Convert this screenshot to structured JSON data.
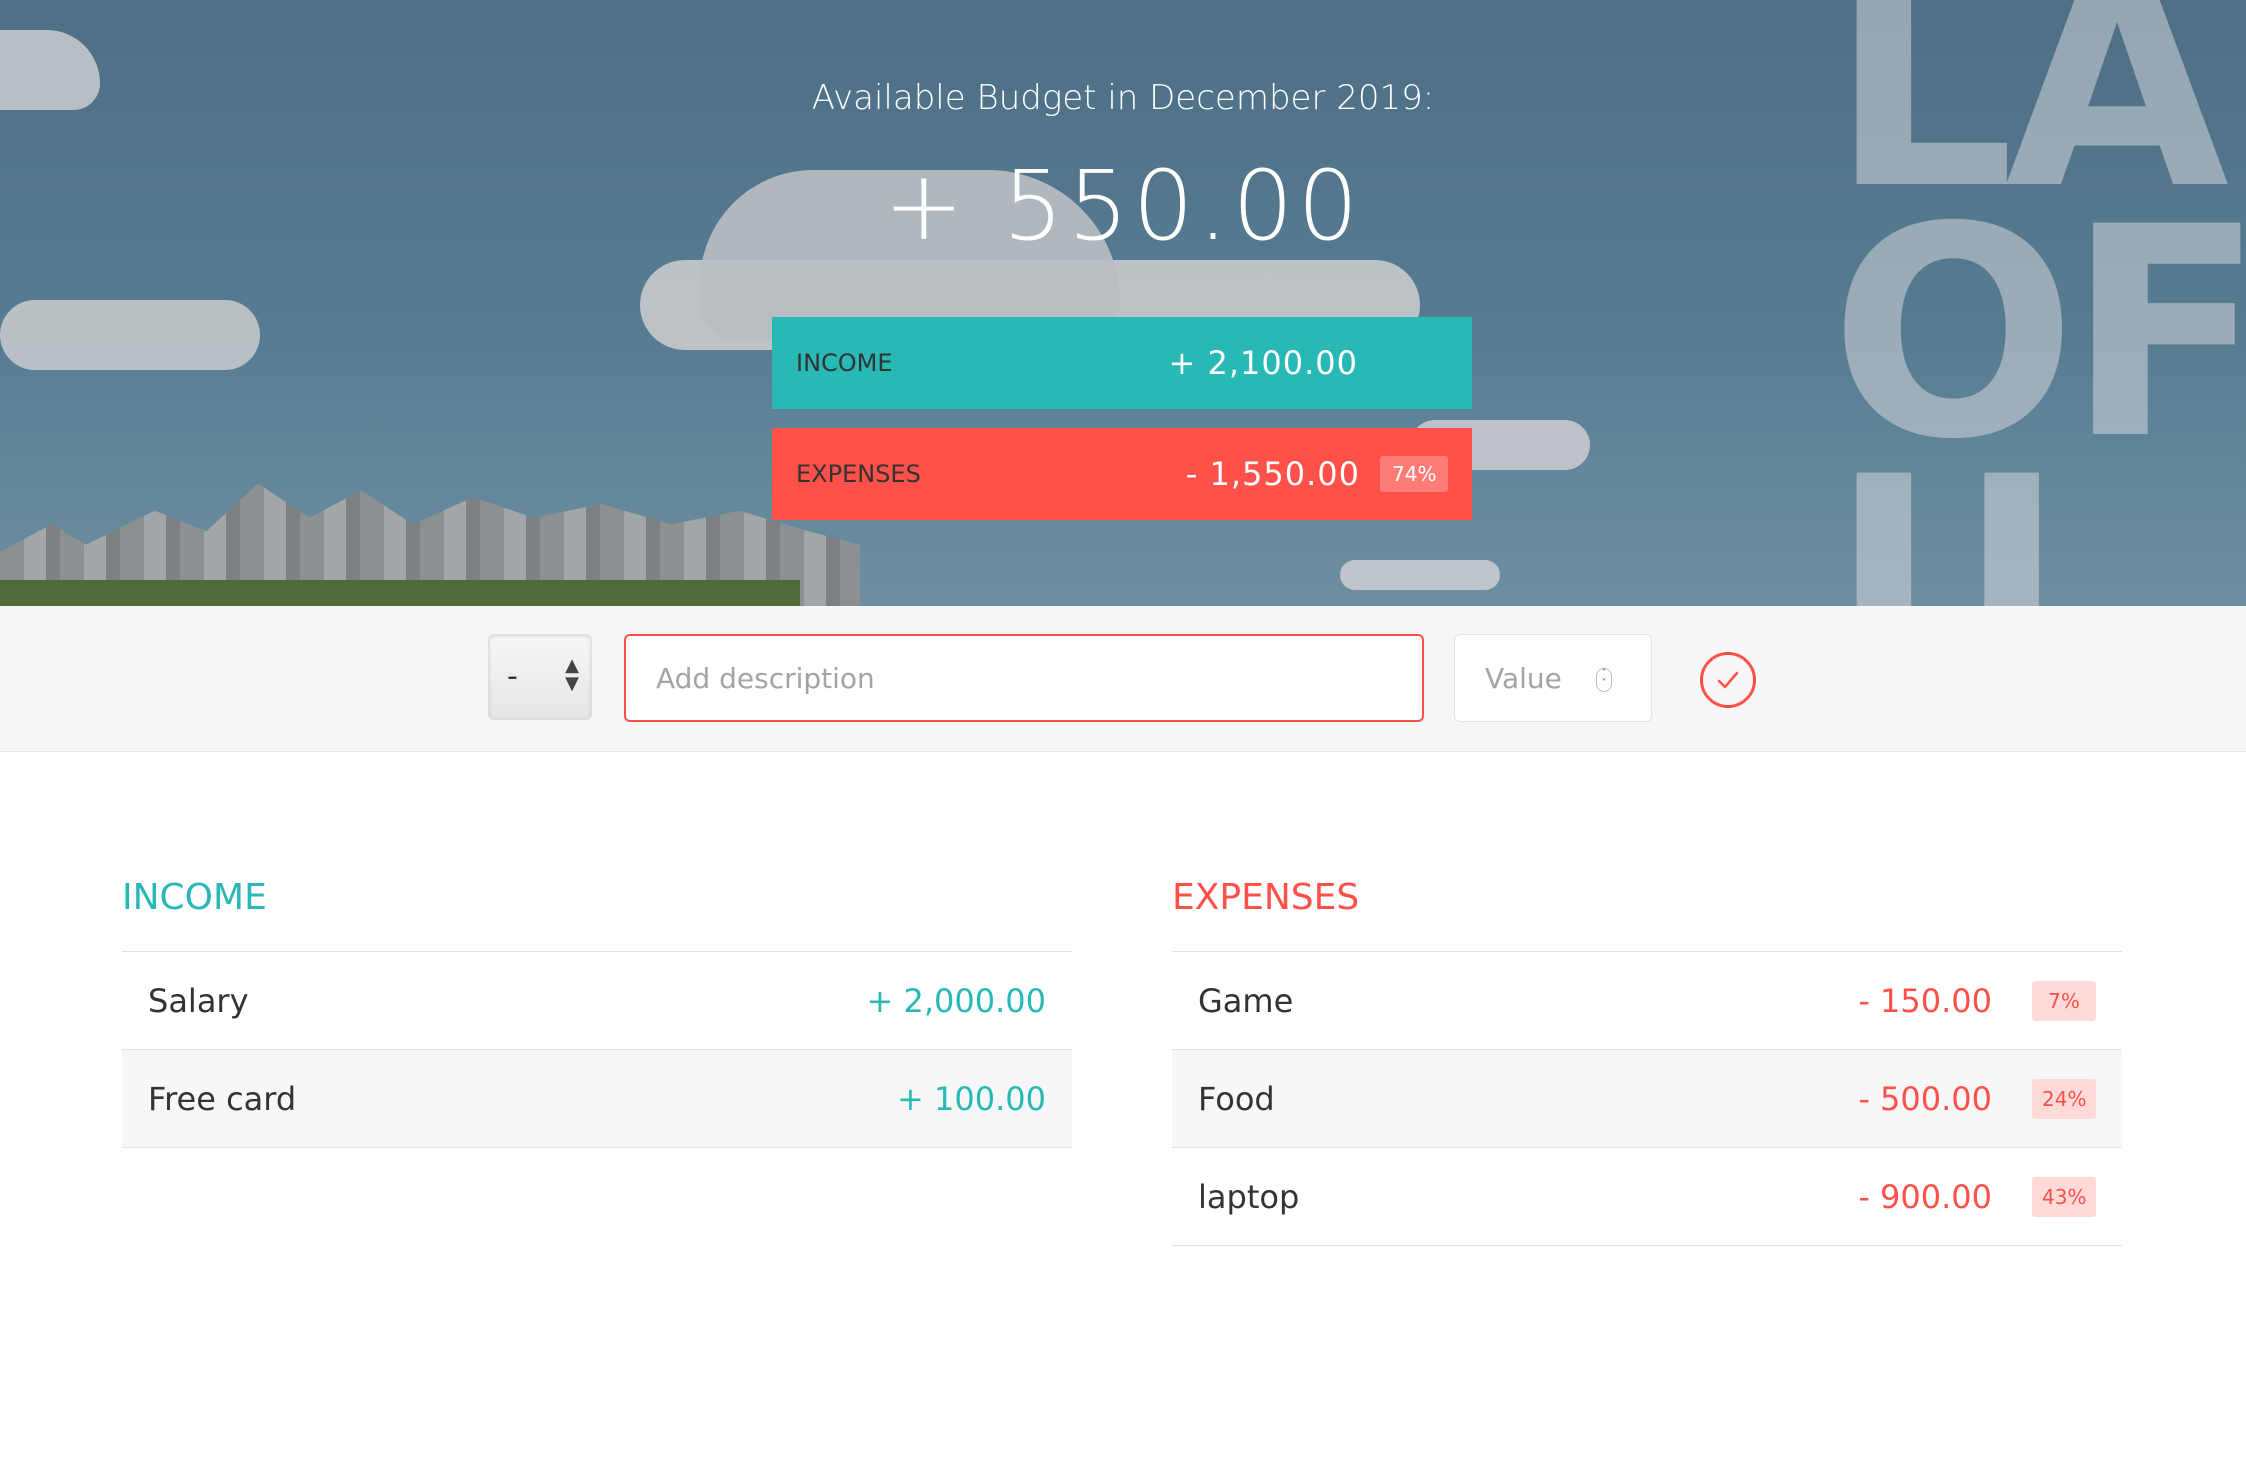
{
  "hero": {
    "title": "Available Budget in December 2019:",
    "budget": "+ 550.00",
    "income": {
      "label": "INCOME",
      "value": "+ 2,100.00"
    },
    "expenses": {
      "label": "EXPENSES",
      "value": "- 1,550.00",
      "percentage": "74%"
    }
  },
  "add_form": {
    "type_value": "-",
    "description_placeholder": "Add description",
    "value_placeholder": "Value",
    "submit_icon": "checkmark-icon"
  },
  "income_list": {
    "title": "INCOME",
    "items": [
      {
        "description": "Salary",
        "value": "+ 2,000.00"
      },
      {
        "description": "Free card",
        "value": "+ 100.00"
      }
    ]
  },
  "expenses_list": {
    "title": "EXPENSES",
    "items": [
      {
        "description": "Game",
        "value": "- 150.00",
        "percentage": "7%"
      },
      {
        "description": "Food",
        "value": "- 500.00",
        "percentage": "24%"
      },
      {
        "description": "laptop",
        "value": "- 900.00",
        "percentage": "43%"
      }
    ]
  },
  "colors": {
    "income": "#28b9b5",
    "expenses": "#ff5049"
  }
}
